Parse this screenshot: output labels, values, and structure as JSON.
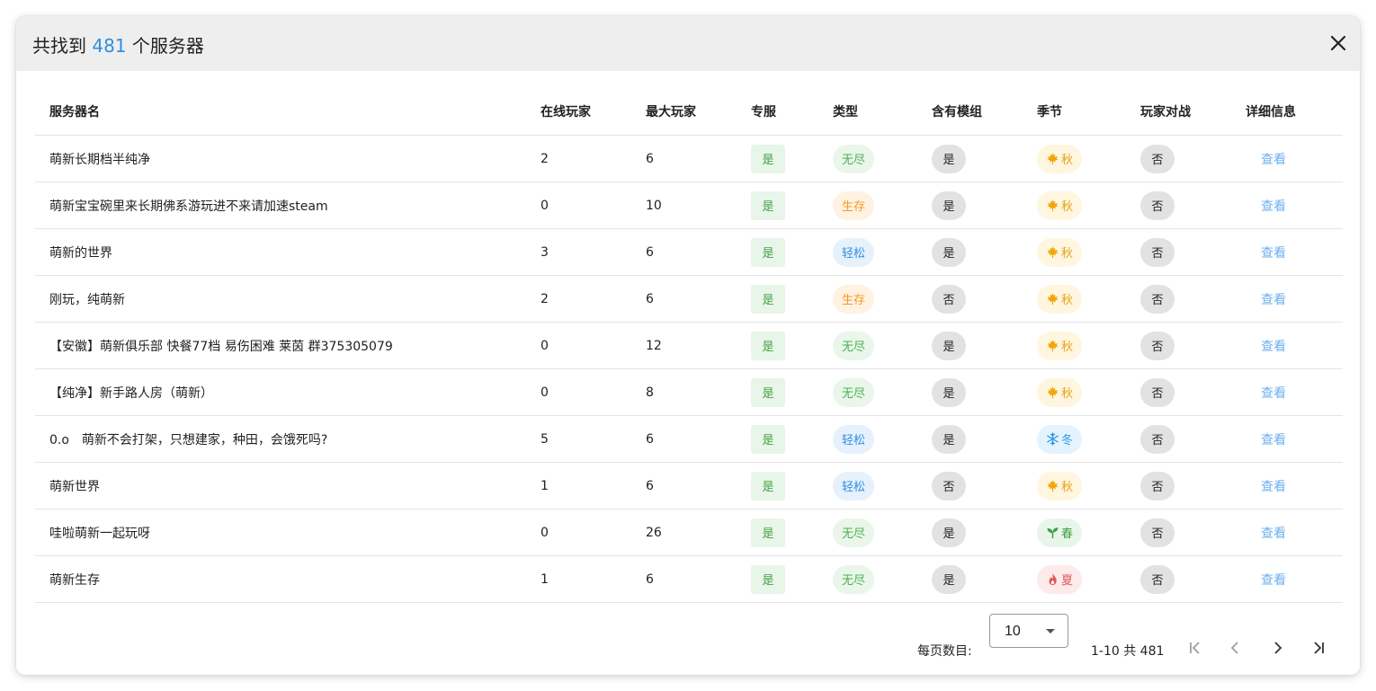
{
  "dialog": {
    "title_prefix": "共找到",
    "title_count": "481",
    "title_suffix": "个服务器"
  },
  "columns": [
    "服务器名",
    "在线玩家",
    "最大玩家",
    "专服",
    "类型",
    "含有模组",
    "季节",
    "玩家对战",
    "详细信息"
  ],
  "rows": [
    {
      "name": "萌新长期档半纯净",
      "online": "2",
      "max": "6",
      "dedicated": "是",
      "type": "无尽",
      "type_key": "endless",
      "mods": "是",
      "season": "秋",
      "season_key": "autumn",
      "pvp": "否",
      "detail": "查看"
    },
    {
      "name": "萌新宝宝碗里来长期佛系游玩进不来请加速steam",
      "online": "0",
      "max": "10",
      "dedicated": "是",
      "type": "生存",
      "type_key": "survival",
      "mods": "是",
      "season": "秋",
      "season_key": "autumn",
      "pvp": "否",
      "detail": "查看"
    },
    {
      "name": "萌新的世界",
      "online": "3",
      "max": "6",
      "dedicated": "是",
      "type": "轻松",
      "type_key": "relaxed",
      "mods": "是",
      "season": "秋",
      "season_key": "autumn",
      "pvp": "否",
      "detail": "查看"
    },
    {
      "name": "刚玩，纯萌新",
      "online": "2",
      "max": "6",
      "dedicated": "是",
      "type": "生存",
      "type_key": "survival",
      "mods": "否",
      "season": "秋",
      "season_key": "autumn",
      "pvp": "否",
      "detail": "查看"
    },
    {
      "name": "【安徽】萌新俱乐部 快餐77档 易伤困难 莱茵 群375305079",
      "online": "0",
      "max": "12",
      "dedicated": "是",
      "type": "无尽",
      "type_key": "endless",
      "mods": "是",
      "season": "秋",
      "season_key": "autumn",
      "pvp": "否",
      "detail": "查看"
    },
    {
      "name": "【纯净】新手路人房（萌新）",
      "online": "0",
      "max": "8",
      "dedicated": "是",
      "type": "无尽",
      "type_key": "endless",
      "mods": "是",
      "season": "秋",
      "season_key": "autumn",
      "pvp": "否",
      "detail": "查看"
    },
    {
      "name": "0.o　萌新不会打架，只想建家，种田，会饿死吗?",
      "online": "5",
      "max": "6",
      "dedicated": "是",
      "type": "轻松",
      "type_key": "relaxed",
      "mods": "是",
      "season": "冬",
      "season_key": "winter",
      "pvp": "否",
      "detail": "查看"
    },
    {
      "name": "萌新世界",
      "online": "1",
      "max": "6",
      "dedicated": "是",
      "type": "轻松",
      "type_key": "relaxed",
      "mods": "否",
      "season": "秋",
      "season_key": "autumn",
      "pvp": "否",
      "detail": "查看"
    },
    {
      "name": "哇啦萌新一起玩呀",
      "online": "0",
      "max": "26",
      "dedicated": "是",
      "type": "无尽",
      "type_key": "endless",
      "mods": "是",
      "season": "春",
      "season_key": "spring",
      "pvp": "否",
      "detail": "查看"
    },
    {
      "name": "萌新生存",
      "online": "1",
      "max": "6",
      "dedicated": "是",
      "type": "无尽",
      "type_key": "endless",
      "mods": "是",
      "season": "夏",
      "season_key": "summer",
      "pvp": "否",
      "detail": "查看"
    }
  ],
  "pagination": {
    "per_page_label": "每页数目:",
    "per_page_value": "10",
    "range_label": "1-10 共 481"
  },
  "icons": {
    "close": "close-icon",
    "autumn": "maple-leaf-icon",
    "winter": "snowflake-icon",
    "spring": "sprout-icon",
    "summer": "flame-icon",
    "first": "first-page-icon",
    "prev": "chevron-left-icon",
    "next": "chevron-right-icon",
    "last": "last-page-icon"
  },
  "colors": {
    "accent": "#2f8fe0",
    "link": "#6cb0ee",
    "header_bg": "#eeeeee"
  }
}
